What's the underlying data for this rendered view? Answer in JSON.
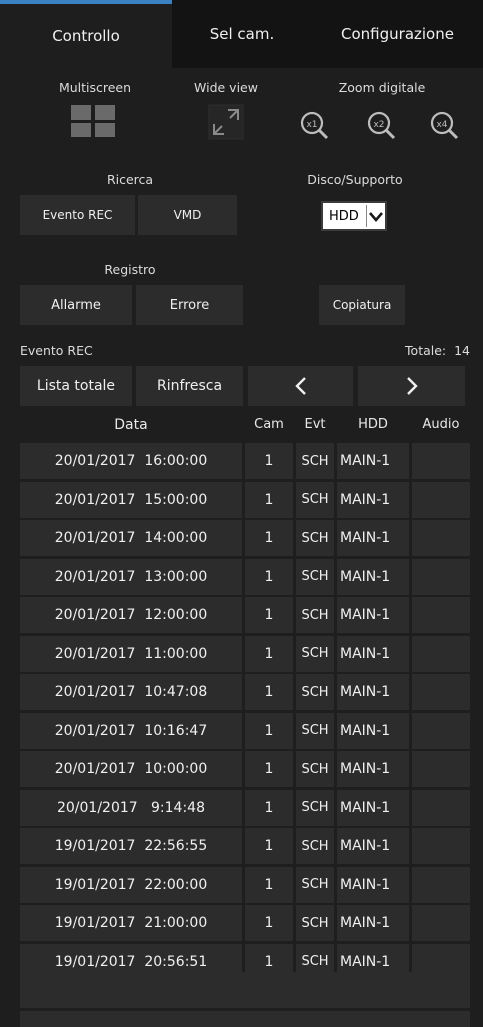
{
  "tabs": [
    {
      "label": "Controllo",
      "active": true
    },
    {
      "label": "Sel cam.",
      "active": false
    },
    {
      "label": "Configurazione",
      "active": false
    }
  ],
  "top": {
    "multiscreen": "Multiscreen",
    "wide_view": "Wide view",
    "zoom": "Zoom digitale",
    "zoom_icons": [
      "x1",
      "x2",
      "x4"
    ]
  },
  "ricerca": {
    "label": "Ricerca",
    "evento_rec": "Evento REC",
    "vmd": "VMD"
  },
  "disco": {
    "label": "Disco/Supporto",
    "selected": "HDD"
  },
  "registro": {
    "label": "Registro",
    "allarme": "Allarme",
    "errore": "Errore"
  },
  "copiatura": "Copiatura",
  "evento_rec_label": "Evento REC",
  "totale": "Totale:  14",
  "controls": {
    "lista_totale": "Lista totale",
    "rinfresca": "Rinfresca",
    "prev": "<",
    "next": ">"
  },
  "table": {
    "headers": [
      "Data",
      "Cam",
      "Evt",
      "HDD",
      "Audio"
    ],
    "rows": [
      {
        "data": "20/01/2017  16:00:00",
        "cam": "1",
        "evt": "SCH",
        "hdd": "MAIN-1",
        "audio": ""
      },
      {
        "data": "20/01/2017  15:00:00",
        "cam": "1",
        "evt": "SCH",
        "hdd": "MAIN-1",
        "audio": ""
      },
      {
        "data": "20/01/2017  14:00:00",
        "cam": "1",
        "evt": "SCH",
        "hdd": "MAIN-1",
        "audio": ""
      },
      {
        "data": "20/01/2017  13:00:00",
        "cam": "1",
        "evt": "SCH",
        "hdd": "MAIN-1",
        "audio": ""
      },
      {
        "data": "20/01/2017  12:00:00",
        "cam": "1",
        "evt": "SCH",
        "hdd": "MAIN-1",
        "audio": ""
      },
      {
        "data": "20/01/2017  11:00:00",
        "cam": "1",
        "evt": "SCH",
        "hdd": "MAIN-1",
        "audio": ""
      },
      {
        "data": "20/01/2017  10:47:08",
        "cam": "1",
        "evt": "SCH",
        "hdd": "MAIN-1",
        "audio": ""
      },
      {
        "data": "20/01/2017  10:16:47",
        "cam": "1",
        "evt": "SCH",
        "hdd": "MAIN-1",
        "audio": ""
      },
      {
        "data": "20/01/2017  10:00:00",
        "cam": "1",
        "evt": "SCH",
        "hdd": "MAIN-1",
        "audio": ""
      },
      {
        "data": "20/01/2017   9:14:48",
        "cam": "1",
        "evt": "SCH",
        "hdd": "MAIN-1",
        "audio": ""
      },
      {
        "data": "19/01/2017  22:56:55",
        "cam": "1",
        "evt": "SCH",
        "hdd": "MAIN-1",
        "audio": ""
      },
      {
        "data": "19/01/2017  22:00:00",
        "cam": "1",
        "evt": "SCH",
        "hdd": "MAIN-1",
        "audio": ""
      },
      {
        "data": "19/01/2017  21:00:00",
        "cam": "1",
        "evt": "SCH",
        "hdd": "MAIN-1",
        "audio": ""
      },
      {
        "data": "19/01/2017  20:56:51",
        "cam": "1",
        "evt": "SCH",
        "hdd": "MAIN-1",
        "audio": ""
      }
    ]
  },
  "colors": {
    "background": "#1e1e1e",
    "button": "#2c2c2c",
    "tab_accent": "#3b82c4",
    "text": "#f0f0f0"
  }
}
